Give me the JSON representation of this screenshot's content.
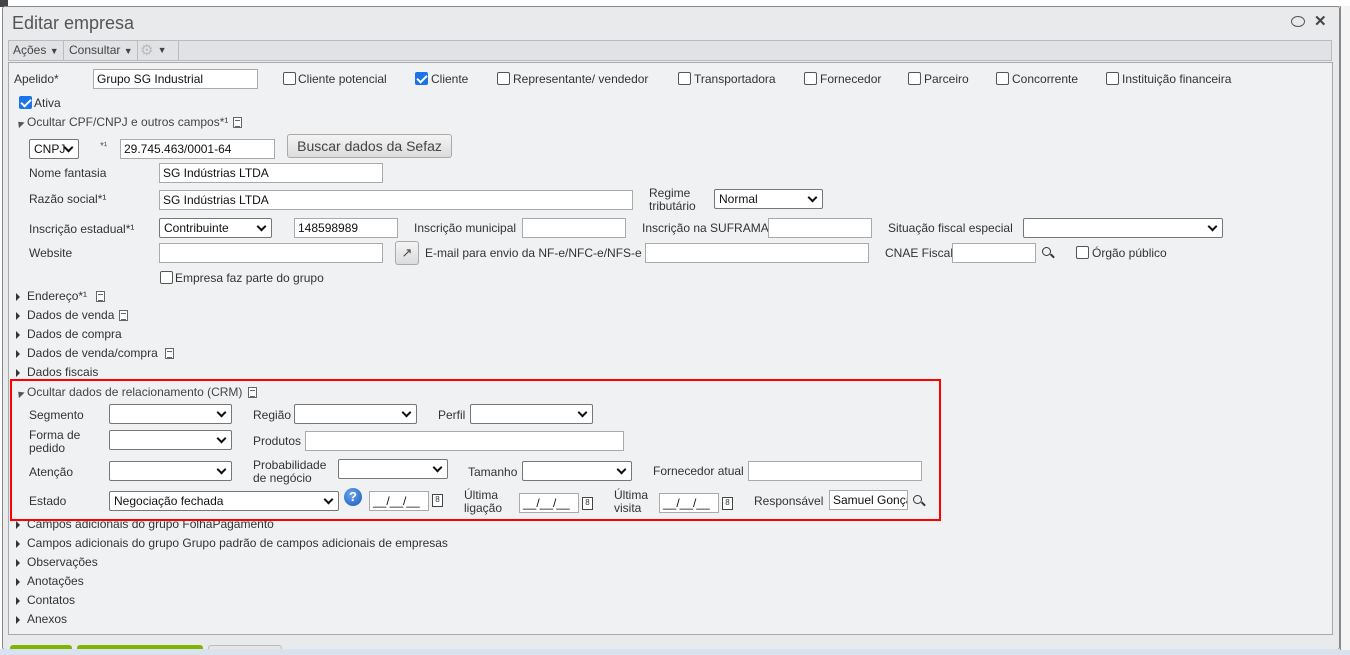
{
  "window": {
    "title": "Editar empresa"
  },
  "toolbar": {
    "acoes": "Ações",
    "consultar": "Consultar"
  },
  "main": {
    "apelido_label": "Apelido*",
    "apelido_value": "Grupo SG Industrial",
    "types": [
      {
        "label": "Cliente potencial",
        "checked": false
      },
      {
        "label": "Cliente",
        "checked": true
      },
      {
        "label": "Representante/ vendedor",
        "checked": false
      },
      {
        "label": "Transportadora",
        "checked": false
      },
      {
        "label": "Fornecedor",
        "checked": false
      },
      {
        "label": "Parceiro",
        "checked": false
      },
      {
        "label": "Concorrente",
        "checked": false
      },
      {
        "label": "Instituição financeira",
        "checked": false
      }
    ],
    "ativa_label": "Ativa",
    "cpf_section": "Ocultar CPF/CNPJ e outros campos*¹",
    "doc_type": "CNPJ",
    "doc_mark": "*¹",
    "doc_value": "29.745.463/0001-64",
    "sefaz_button": "Buscar dados da Sefaz",
    "nome_fantasia_label": "Nome fantasia",
    "nome_fantasia_value": "SG Indústrias LTDA",
    "razao_label": "Razão social*¹",
    "razao_value": "SG Indústrias LTDA",
    "regime_label1": "Regime",
    "regime_label2": "tributário",
    "regime_value": "Normal",
    "ie_label": "Inscrição estadual*¹",
    "ie_type": "Contribuinte",
    "ie_value": "148598989",
    "im_label": "Inscrição municipal",
    "suframa_label": "Inscrição na SUFRAMA",
    "situacao_label": "Situação fiscal especial",
    "website_label": "Website",
    "email_label": "E-mail para envio da NF-e/NFC-e/NFS-e",
    "cnae_label": "CNAE Fiscal",
    "orgao_label": "Órgão público",
    "grupo_label": "Empresa faz parte do grupo"
  },
  "sections": [
    "Endereço*¹",
    "Dados de venda",
    "Dados de compra",
    "Dados de venda/compra",
    "Dados fiscais"
  ],
  "crm": {
    "title": "Ocultar dados de relacionamento (CRM)",
    "segmento": "Segmento",
    "regiao": "Região",
    "perfil": "Perfil",
    "forma1": "Forma de",
    "forma2": "pedido",
    "produtos": "Produtos",
    "atencao": "Atenção",
    "prob1": "Probabilidade",
    "prob2": "de negócio",
    "tamanho": "Tamanho",
    "fornecedor": "Fornecedor atual",
    "estado": "Estado",
    "estado_value": "Negociação fechada",
    "help": "?",
    "date_placeholder": "__/__/__",
    "lig1": "Última",
    "lig2": "ligação",
    "vis1": "Última",
    "vis2": "visita",
    "responsavel": "Responsável",
    "responsavel_value": "Samuel Gonça"
  },
  "sections2": [
    "Campos adicionais do grupo FolhaPagamento",
    "Campos adicionais do grupo Grupo padrão de campos adicionais de empresas",
    "Observações",
    "Anotações",
    "Contatos",
    "Anexos"
  ]
}
